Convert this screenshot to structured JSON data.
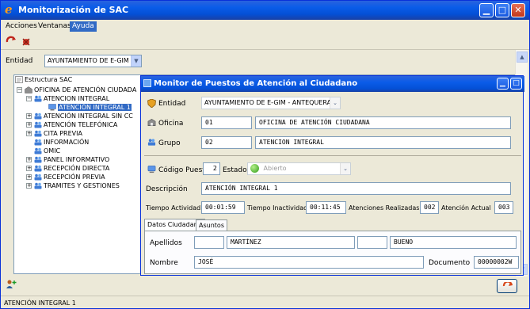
{
  "window": {
    "title": "Monitorización de SAC"
  },
  "menu": [
    "Acciones",
    "Ventanas",
    "Ayuda"
  ],
  "entidad": {
    "label": "Entidad",
    "value": "AYUNTAMIENTO DE E-GIM"
  },
  "tree": {
    "items": [
      {
        "label": "Estructura SAC",
        "level": 0,
        "expander": ""
      },
      {
        "label": "OFICINA DE ATENCIÓN CIUDADA",
        "level": 1,
        "expander": "−"
      },
      {
        "label": "ATENCION INTEGRAL",
        "level": 2,
        "expander": "−"
      },
      {
        "label": "ATENCIÓN INTEGRAL 1",
        "level": 3,
        "expander": "",
        "selected": true
      },
      {
        "label": "ATENCIÓN INTEGRAL SIN CC",
        "level": 2,
        "expander": "+"
      },
      {
        "label": "ATENCIÓN TELEFÓNICA",
        "level": 2,
        "expander": "+"
      },
      {
        "label": "CITA PREVIA",
        "level": 2,
        "expander": "+"
      },
      {
        "label": "INFORMACIÓN",
        "level": 2,
        "expander": ""
      },
      {
        "label": "OMIC",
        "level": 2,
        "expander": ""
      },
      {
        "label": "PANEL INFORMATIVO",
        "level": 2,
        "expander": "+"
      },
      {
        "label": "RECEPCIÓN DIRECTA",
        "level": 2,
        "expander": "+"
      },
      {
        "label": "RECEPCIÓN PREVIA",
        "level": 2,
        "expander": "+"
      },
      {
        "label": "TRAMITES Y GESTIONES",
        "level": 2,
        "expander": "+"
      }
    ]
  },
  "monitor": {
    "title": "Monitor de Puestos de Atención al Ciudadano",
    "entidad_label": "Entidad",
    "entidad_value": "AYUNTAMIENTO DE E-GIM - ANTEQUERA",
    "oficina_label": "Oficina",
    "oficina_code": "01",
    "oficina_name": "OFICINA DE ATENCIÓN CIUDADANA",
    "grupo_label": "Grupo",
    "grupo_code": "02",
    "grupo_name": "ATENCION INTEGRAL",
    "codigo_label": "Código Puesto",
    "codigo_value": "2",
    "estado_label": "Estado",
    "estado_value": "Abierto",
    "descripcion_label": "Descripción",
    "descripcion_value": "ATENCIÓN INTEGRAL 1",
    "tiempo_actividad_label": "Tiempo Actividad",
    "tiempo_actividad_value": "00:01:59",
    "tiempo_inactividad_label": "Tiempo Inactividad",
    "tiempo_inactividad_value": "00:11:45",
    "atenciones_label": "Atenciones Realizadas",
    "atenciones_value": "002",
    "atencion_actual_label": "Atención Actual",
    "atencion_actual_value": "003",
    "tabs": [
      "Datos Ciudadano",
      "Asuntos"
    ],
    "apellidos_label": "Apellidos",
    "apellido1": "MARTÍNEZ",
    "apellido2": "BUENO",
    "nombre_label": "Nombre",
    "nombre_value": "JOSÉ",
    "documento_label": "Documento",
    "documento_value": "00000002W"
  },
  "status": {
    "text": "ATENCIÓN INTEGRAL 1"
  }
}
